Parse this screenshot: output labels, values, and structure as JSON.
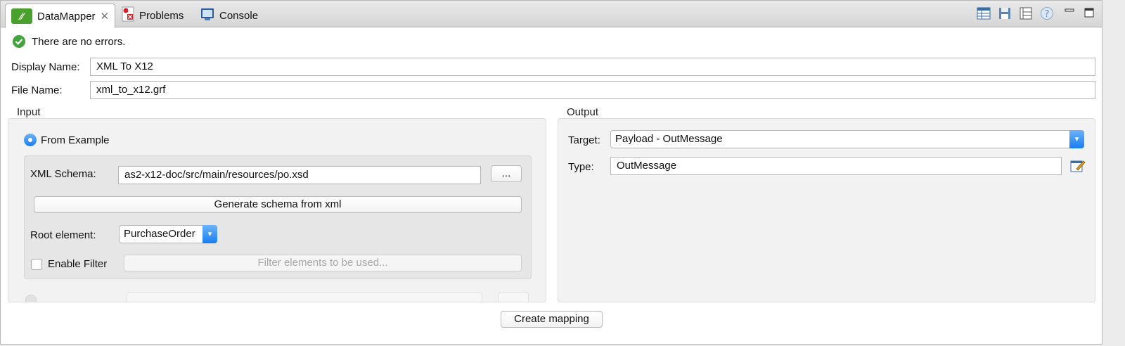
{
  "tabs": [
    {
      "label": "DataMapper",
      "active": true,
      "icon": "datamapper-icon"
    },
    {
      "label": "Problems",
      "active": false,
      "icon": "problems-icon"
    },
    {
      "label": "Console",
      "active": false,
      "icon": "console-icon"
    }
  ],
  "toolbar_icons": [
    "table-icon",
    "save-icon",
    "tree-icon",
    "help-icon",
    "minimize-icon",
    "maximize-icon"
  ],
  "status": {
    "text": "There are no errors.",
    "icon": "check-circle-icon",
    "color": "#43a33c"
  },
  "display_name": {
    "label": "Display Name:",
    "value": "XML To X12"
  },
  "file_name": {
    "label": "File Name:",
    "value": "xml_to_x12.grf"
  },
  "input": {
    "title": "Input",
    "from_example": "From Example",
    "xml_schema": {
      "label": "XML Schema:",
      "value": "as2-x12-doc/src/main/resources/po.xsd",
      "browse": "..."
    },
    "generate_button": "Generate schema from xml",
    "root_element": {
      "label": "Root element:",
      "value": "PurchaseOrder"
    },
    "enable_filter": {
      "label": "Enable Filter",
      "checked": false
    },
    "filter_placeholder": "Filter elements to be used..."
  },
  "output": {
    "title": "Output",
    "target": {
      "label": "Target:",
      "value": "Payload - OutMessage"
    },
    "type": {
      "label": "Type:",
      "value": "OutMessage",
      "icon": "edit-icon"
    }
  },
  "create_button": "Create mapping",
  "colors": {
    "accent": "#1a7ef0",
    "success": "#43a33c",
    "brand": "#4aa02c"
  }
}
